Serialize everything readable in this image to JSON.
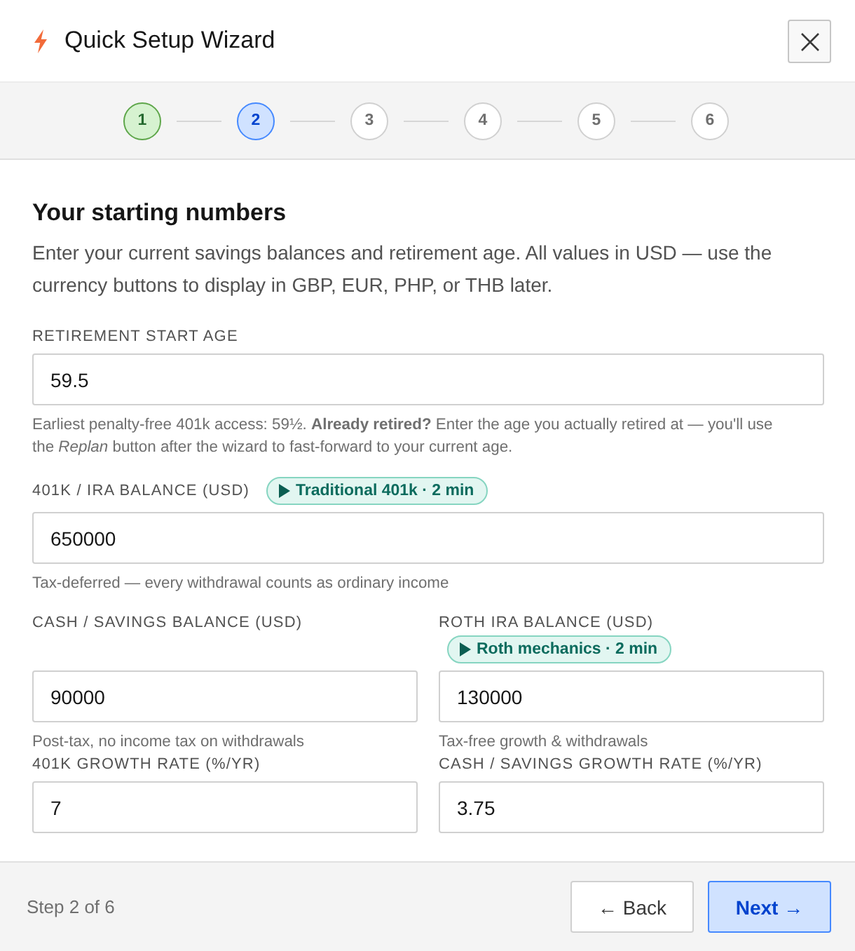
{
  "window": {
    "title": "Quick Setup Wizard"
  },
  "stepper": {
    "steps": [
      {
        "label": "1",
        "completed": true,
        "selected": false
      },
      {
        "label": "2",
        "completed": false,
        "selected": true
      },
      {
        "label": "3",
        "completed": false,
        "selected": false
      },
      {
        "label": "4",
        "completed": false,
        "selected": false
      },
      {
        "label": "5",
        "completed": false,
        "selected": false
      },
      {
        "label": "6",
        "completed": false,
        "selected": false
      }
    ]
  },
  "section": {
    "heading": "Your starting numbers",
    "intro": "Enter your current savings balances and retirement age. All values in USD — use the currency buttons to display in GBP, EUR, PHP, or THB later."
  },
  "rows": [
    {
      "fields": [
        {
          "label": "RETIREMENT START AGE",
          "value": "59.5",
          "help": "Earliest penalty-free 401k access: 59½. **Already retired?** Enter the age you actually retired at — you'll use the *Replan* button after the wizard to fast-forward to your current age."
        }
      ]
    },
    {
      "fields": [
        {
          "label": "401K / IRA BALANCE (USD)",
          "badge": "Traditional 401k · 2 min",
          "value": "650000",
          "help": "Tax-deferred — every withdrawal counts as ordinary income"
        }
      ]
    },
    {
      "fields": [
        {
          "label": "CASH / SAVINGS BALANCE (USD)",
          "value": "90000",
          "help": "Post-tax, no income tax on withdrawals"
        },
        {
          "label": "ROTH IRA BALANCE (USD)",
          "badge": "Roth mechanics · 2 min",
          "value": "130000",
          "help": "Tax-free growth & withdrawals"
        }
      ]
    },
    {
      "fields": [
        {
          "label": "401K GROWTH RATE (%/YR)",
          "value": "7"
        },
        {
          "label": "CASH / SAVINGS GROWTH RATE (%/YR)",
          "value": "3.75"
        }
      ]
    }
  ],
  "footer": {
    "step_text": "Step 2 of 6",
    "buttons": [
      {
        "label": "← Back",
        "kind": "back"
      },
      {
        "label": "Next →",
        "kind": "next"
      }
    ]
  }
}
